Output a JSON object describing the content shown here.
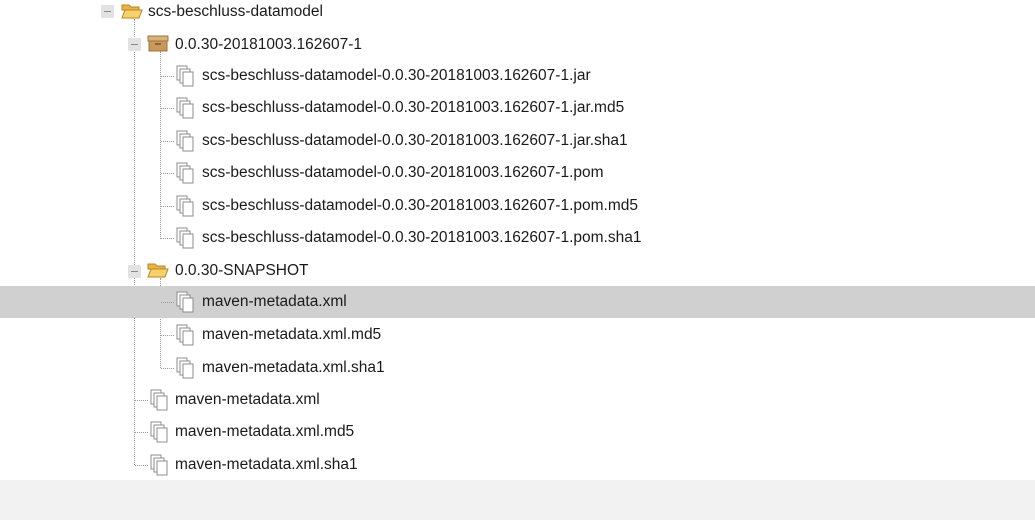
{
  "tree": {
    "root": {
      "label": "scs-beschluss-datamodel",
      "icon": "folder-open-icon"
    },
    "version": {
      "label": "0.0.30-20181003.162607-1",
      "icon": "package-box-icon",
      "files": [
        "scs-beschluss-datamodel-0.0.30-20181003.162607-1.jar",
        "scs-beschluss-datamodel-0.0.30-20181003.162607-1.jar.md5",
        "scs-beschluss-datamodel-0.0.30-20181003.162607-1.jar.sha1",
        "scs-beschluss-datamodel-0.0.30-20181003.162607-1.pom",
        "scs-beschluss-datamodel-0.0.30-20181003.162607-1.pom.md5",
        "scs-beschluss-datamodel-0.0.30-20181003.162607-1.pom.sha1"
      ]
    },
    "snapshot": {
      "label": "0.0.30-SNAPSHOT",
      "icon": "folder-open-icon",
      "files": [
        "maven-metadata.xml",
        "maven-metadata.xml.md5",
        "maven-metadata.xml.sha1"
      ],
      "selected_file": "maven-metadata.xml"
    },
    "root_files": [
      "maven-metadata.xml",
      "maven-metadata.xml.md5",
      "maven-metadata.xml.sha1"
    ]
  },
  "colors": {
    "selected_row": "#d0d0d0",
    "folder": "#f5c95a",
    "package": "#c9a15c"
  }
}
